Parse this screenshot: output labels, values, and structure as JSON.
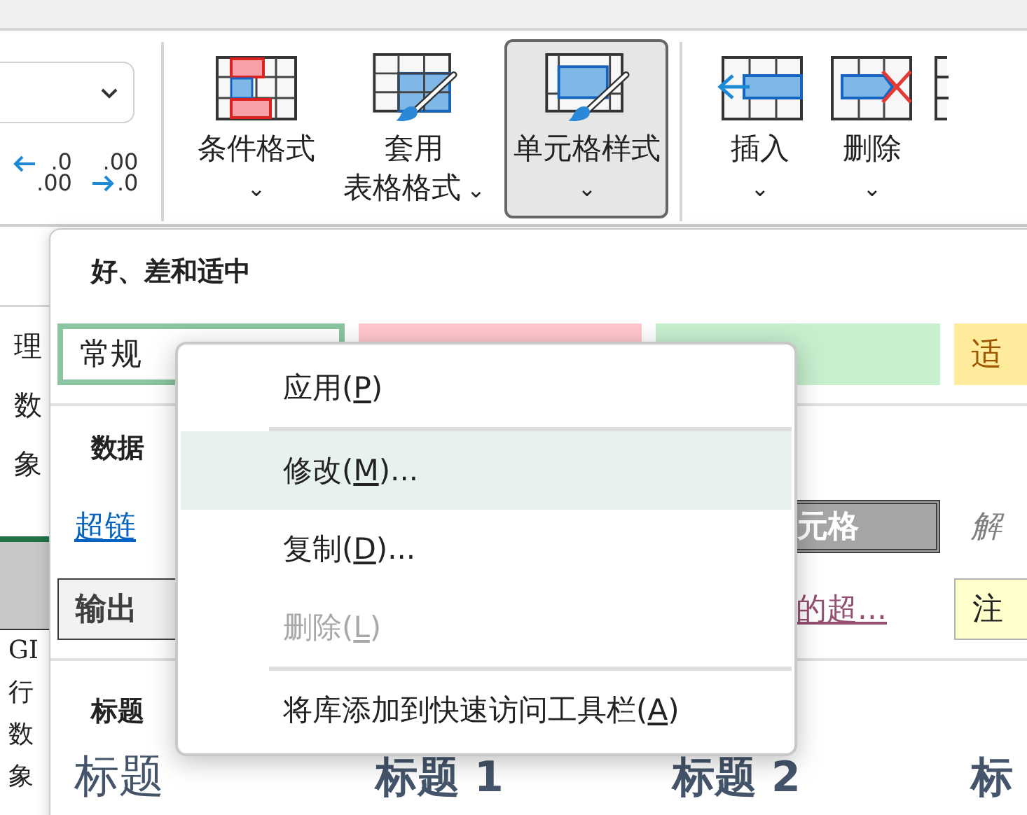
{
  "ribbon": {
    "decimal_buttons": [
      {
        "kind": "increase",
        "top": ".0",
        "bottom": ".00"
      },
      {
        "kind": "decrease",
        "top": ".00",
        "bottom": ".0"
      }
    ],
    "buttons": [
      {
        "kind": "conditional",
        "label": [
          "条件格式"
        ],
        "caret": "⌄",
        "pressed": false
      },
      {
        "kind": "table",
        "label": [
          "套用",
          "表格格式"
        ],
        "caret": "⌄",
        "pressed": false
      },
      {
        "kind": "cellstyle",
        "label": [
          "单元格样式"
        ],
        "caret": "⌄",
        "pressed": true
      },
      {
        "kind": "insert",
        "label": [
          "插入"
        ],
        "caret": "⌄",
        "pressed": false
      },
      {
        "kind": "delete",
        "label": [
          "删除"
        ],
        "caret": "⌄",
        "pressed": false
      },
      {
        "kind": "format",
        "pressed": false
      }
    ]
  },
  "sheet": {
    "upper": [
      "理",
      "数",
      "象"
    ],
    "lower": [
      "GI",
      "行",
      "数",
      "象"
    ]
  },
  "gallery": {
    "sections": [
      {
        "title": "好、差和适中",
        "rows": [
          [
            {
              "kind": "normal",
              "text": "常规"
            },
            {
              "kind": "bad"
            },
            {
              "kind": "good"
            },
            {
              "kind": "neutral",
              "text": "适"
            }
          ]
        ]
      },
      {
        "title": "数据",
        "rows": [
          [
            {
              "kind": "link",
              "text": "超链"
            },
            {
              "kind": "empty"
            },
            {
              "kind": "check",
              "text": "元格"
            },
            {
              "kind": "explanatory",
              "text": "解"
            }
          ],
          [
            {
              "kind": "output",
              "text": "输出"
            },
            {
              "kind": "empty"
            },
            {
              "kind": "visited",
              "text": "的超..."
            },
            {
              "kind": "note",
              "text": "注"
            }
          ]
        ]
      },
      {
        "title": "标题",
        "rows": [
          [
            {
              "kind": "title",
              "text": "标题"
            },
            {
              "kind": "heading1",
              "text": "标题 1"
            },
            {
              "kind": "heading2",
              "text": "标题 2"
            },
            {
              "kind": "heading3",
              "text": "标"
            }
          ]
        ]
      }
    ]
  },
  "context_menu": {
    "items": [
      {
        "before": "应用(",
        "key": "P",
        "after": ")",
        "selected": false,
        "disabled": false,
        "separator_after": true
      },
      {
        "before": "修改(",
        "key": "M",
        "after": ")...",
        "selected": true,
        "disabled": false,
        "separator_after": false
      },
      {
        "before": "复制(",
        "key": "D",
        "after": ")...",
        "selected": false,
        "disabled": false,
        "separator_after": false
      },
      {
        "before": "删除(",
        "key": "L",
        "after": ")",
        "selected": false,
        "disabled": true,
        "separator_after": true
      },
      {
        "before": "将库添加到快速访问工具栏(",
        "key": "A",
        "after": ")",
        "selected": false,
        "disabled": false,
        "separator_after": false
      }
    ]
  }
}
